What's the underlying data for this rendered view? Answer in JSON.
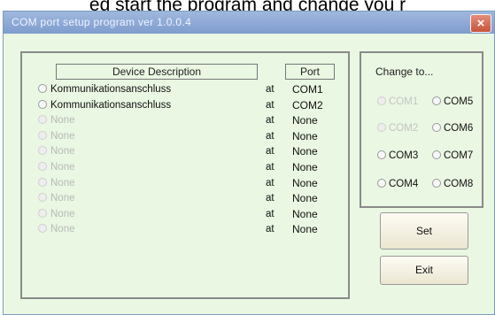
{
  "page_caption": "ed start the program and change you r",
  "window": {
    "title": "COM port setup program ver 1.0.0.4",
    "close_glyph": "×"
  },
  "device_list": {
    "header_description": "Device Description",
    "header_port": "Port",
    "rows": [
      {
        "name": "Kommunikationsanschluss",
        "at": "at",
        "port": "COM1",
        "enabled": true
      },
      {
        "name": "Kommunikationsanschluss",
        "at": "at",
        "port": "COM2",
        "enabled": true
      },
      {
        "name": "None",
        "at": "at",
        "port": "None",
        "enabled": false
      },
      {
        "name": "None",
        "at": "at",
        "port": "None",
        "enabled": false
      },
      {
        "name": "None",
        "at": "at",
        "port": "None",
        "enabled": false
      },
      {
        "name": "None",
        "at": "at",
        "port": "None",
        "enabled": false
      },
      {
        "name": "None",
        "at": "at",
        "port": "None",
        "enabled": false
      },
      {
        "name": "None",
        "at": "at",
        "port": "None",
        "enabled": false
      },
      {
        "name": "None",
        "at": "at",
        "port": "None",
        "enabled": false
      },
      {
        "name": "None",
        "at": "at",
        "port": "None",
        "enabled": false
      }
    ]
  },
  "change_to": {
    "title": "Change to...",
    "options": [
      {
        "label": "COM1",
        "enabled": false
      },
      {
        "label": "COM5",
        "enabled": true
      },
      {
        "label": "COM2",
        "enabled": false
      },
      {
        "label": "COM6",
        "enabled": true
      },
      {
        "label": "COM3",
        "enabled": true
      },
      {
        "label": "COM7",
        "enabled": true
      },
      {
        "label": "COM4",
        "enabled": true
      },
      {
        "label": "COM8",
        "enabled": true
      }
    ]
  },
  "buttons": {
    "set": "Set",
    "exit": "Exit"
  }
}
